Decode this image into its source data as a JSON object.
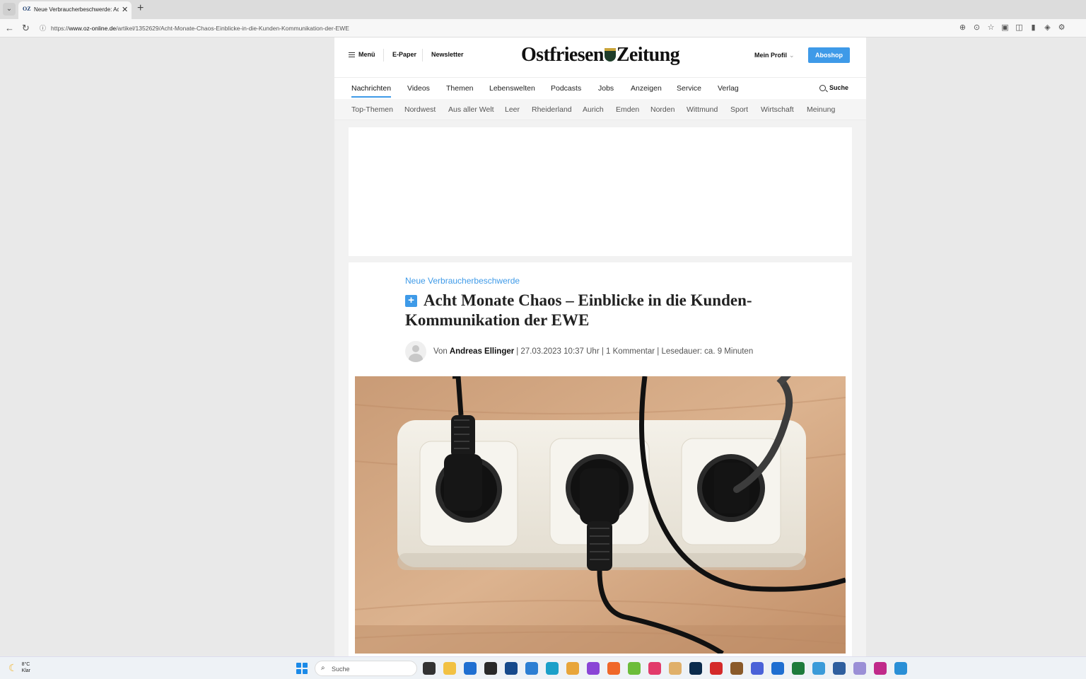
{
  "browser": {
    "tab": {
      "favicon": "OZ",
      "title": "Neue Verbraucherbeschwerde: Acht Monate Chaos",
      "close_glyph": "✕"
    },
    "new_tab_glyph": "+",
    "url": {
      "prefix": "https://",
      "host": "www.oz-online.de",
      "path": "/artikel/1352629/Acht-Monate-Chaos-Einblicke-in-die-Kunden-Kommunikation-der-EWE"
    },
    "icons": [
      "back-icon",
      "reload-icon",
      "zoom-icon",
      "reader-icon",
      "favorite-icon",
      "split-icon",
      "screenshot-icon",
      "extension-icon",
      "shield-icon",
      "settings-icon"
    ]
  },
  "site": {
    "header": {
      "menu_label": "Menü",
      "epaper_label": "E-Paper",
      "newsletter_label": "Newsletter",
      "logo_part1": "Ostfriesen",
      "logo_part2": "Zeitung",
      "profile_label": "Mein Profil",
      "aboshop_label": "Aboshop"
    },
    "main_nav": [
      "Nachrichten",
      "Videos",
      "Themen",
      "Lebenswelten",
      "Podcasts",
      "Jobs",
      "Anzeigen",
      "Service",
      "Verlag"
    ],
    "search_label": "Suche",
    "sub_nav": [
      "Top-Themen",
      "Nordwest",
      "Aus aller Welt",
      "Leer",
      "Rheiderland",
      "Aurich",
      "Emden",
      "Norden",
      "Wittmund",
      "Sport",
      "Wirtschaft",
      "Meinung"
    ],
    "article": {
      "kicker": "Neue Verbraucherbeschwerde",
      "plus_badge": "+",
      "headline": "Acht Monate Chaos – Einblicke in die Kunden-Kommunikation der EWE",
      "byline_prefix": "Von",
      "author": "Andreas Ellinger",
      "byline_meta": "| 27.03.2023 10:37 Uhr | 1 Kommentar | Lesedauer: ca. 9 Minuten"
    }
  },
  "taskbar": {
    "weather_temp": "8°C",
    "weather_desc": "Klar",
    "search_label": "Suche"
  },
  "colors": {
    "accent": "#3e9ae8",
    "text": "#222222",
    "page_bg": "#e9e9e9"
  }
}
